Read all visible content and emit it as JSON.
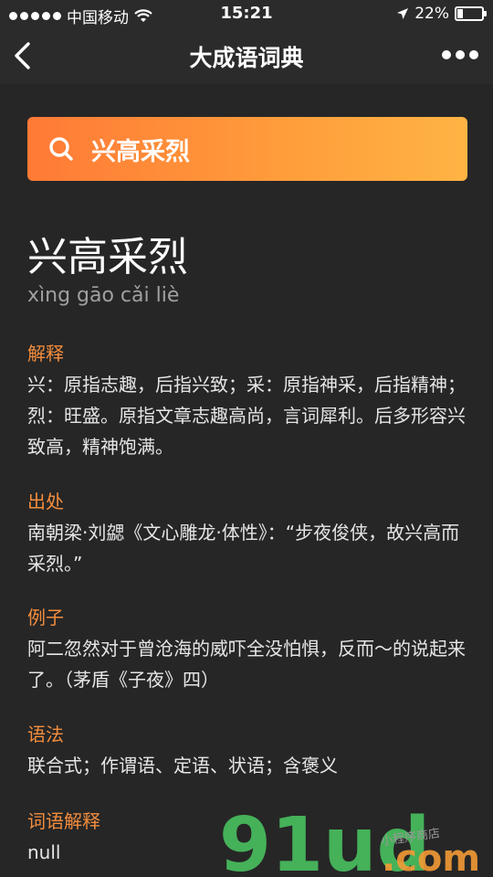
{
  "status_bar": {
    "carrier": "中国移动",
    "time": "15:21",
    "battery": "22%",
    "battery_level": 0.22
  },
  "nav": {
    "title": "大成语词典"
  },
  "search": {
    "query": "兴高采烈"
  },
  "entry": {
    "word": "兴高采烈",
    "pinyin": "xìng gāo cǎi liè",
    "sections": [
      {
        "label": "解释",
        "text": "兴：原指志趣，后指兴致；采：原指神采，后指精神；烈：旺盛。原指文章志趣高尚，言词犀利。后多形容兴致高，精神饱满。"
      },
      {
        "label": "出处",
        "text": "南朝梁·刘勰《文心雕龙·体性》：“步夜俊侠，故兴高而采烈。”"
      },
      {
        "label": "例子",
        "text": "阿二忽然对于曾沧海的威吓全没怕惧，反而～的说起来了。（茅盾《子夜》四）"
      },
      {
        "label": "语法",
        "text": "联合式；作谓语、定语、状语；含褒义"
      },
      {
        "label": "词语解释",
        "text": "null"
      }
    ]
  },
  "watermark": {
    "brand": "91ud",
    "suffix": ".com",
    "tagline": "小程序商店"
  },
  "colors": {
    "background": "#262626",
    "accent": "#f38d3d",
    "search_gradient_start": "#ff7a36",
    "search_gradient_end": "#ffb444"
  }
}
